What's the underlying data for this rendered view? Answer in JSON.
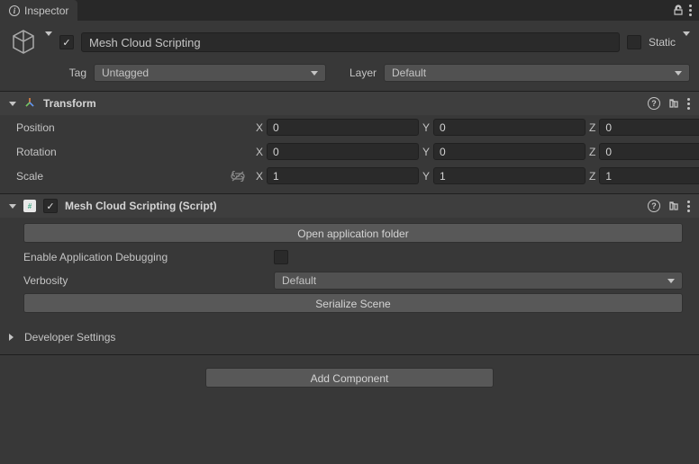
{
  "tab": {
    "title": "Inspector"
  },
  "object": {
    "name": "Mesh Cloud Scripting",
    "enabled": true,
    "static_label": "Static",
    "tag_label": "Tag",
    "tag_value": "Untagged",
    "layer_label": "Layer",
    "layer_value": "Default"
  },
  "transform": {
    "title": "Transform",
    "position_label": "Position",
    "rotation_label": "Rotation",
    "scale_label": "Scale",
    "axes": {
      "x": "X",
      "y": "Y",
      "z": "Z"
    },
    "position": {
      "x": "0",
      "y": "0",
      "z": "0"
    },
    "rotation": {
      "x": "0",
      "y": "0",
      "z": "0"
    },
    "scale": {
      "x": "1",
      "y": "1",
      "z": "1"
    }
  },
  "script": {
    "title": "Mesh Cloud Scripting (Script)",
    "enabled": true,
    "open_folder_btn": "Open application folder",
    "enable_debug_label": "Enable Application Debugging",
    "enable_debug_value": false,
    "verbosity_label": "Verbosity",
    "verbosity_value": "Default",
    "serialize_btn": "Serialize Scene"
  },
  "dev": {
    "title": "Developer Settings"
  },
  "footer": {
    "add_component": "Add Component"
  }
}
